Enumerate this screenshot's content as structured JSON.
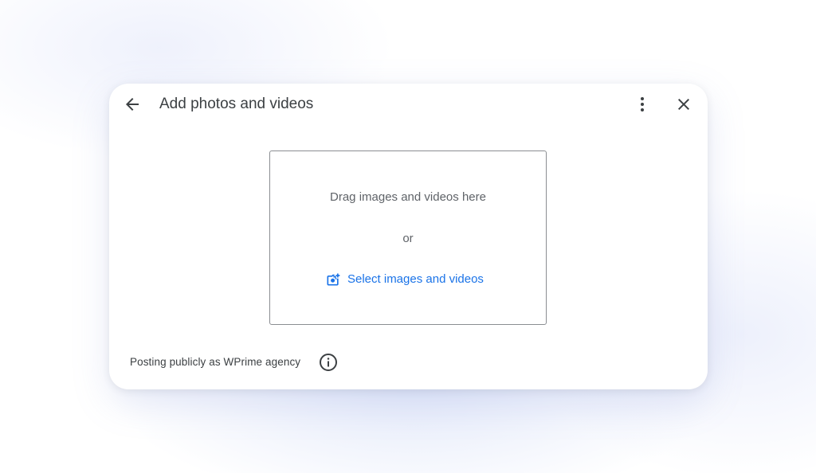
{
  "dialog": {
    "title": "Add photos and videos",
    "icons": {
      "back": "arrow-back-icon",
      "more": "more-vert-icon",
      "close": "close-icon"
    }
  },
  "dropzone": {
    "drag_text": "Drag images and videos here",
    "or_text": "or",
    "select_label": "Select images and videos",
    "select_icon": "add-photo-icon"
  },
  "footer": {
    "posting_text": "Posting publicly as WPrime agency",
    "info_icon": "info-icon"
  },
  "colors": {
    "accent": "#1a73e8",
    "title_text": "#3c4043",
    "secondary_text": "#5f6368",
    "border": "#8a8d91"
  }
}
